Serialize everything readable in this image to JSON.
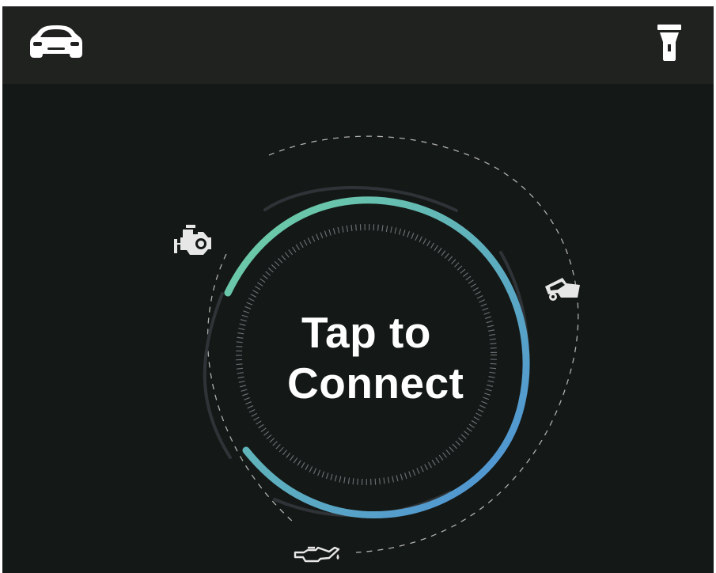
{
  "header": {
    "left_icon": "car-icon",
    "right_icon": "flashlight-icon"
  },
  "connect": {
    "line1": "Tap to",
    "line2": "Connect"
  },
  "gauge_icons": [
    "engine-check-icon",
    "car-door-icon",
    "oil-can-icon"
  ],
  "colors": {
    "background": "#141816",
    "header_background": "#202220",
    "arc_gradient_start": "#6fd0a2",
    "arc_gradient_end": "#4d8fd8",
    "text": "#ffffff"
  }
}
